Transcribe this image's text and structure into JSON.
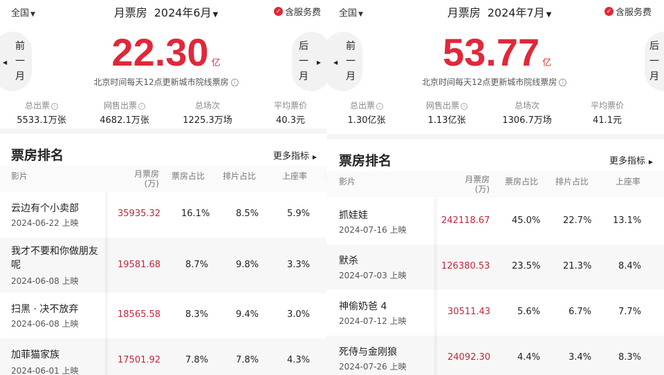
{
  "left": {
    "city": "全国",
    "month_label": "月票房",
    "month_value": "2024年6月",
    "service_fee": "含服务费",
    "prev_line1": "前",
    "prev_line2": "一",
    "prev_line3": "月",
    "next_line1": "后",
    "next_line2": "一",
    "next_line3": "月",
    "box_office": "22.30",
    "box_office_unit": "亿",
    "update_note": "北京时间每天12点更新城市院线票房",
    "stats": [
      {
        "label": "总出票",
        "value": "5533.1万张"
      },
      {
        "label": "网售出票",
        "value": "4682.1万张"
      },
      {
        "label": "总场次",
        "value": "1225.3万场"
      },
      {
        "label": "平均票价",
        "value": "40.3元"
      }
    ],
    "section_title": "票房排名",
    "more_label": "更多指标",
    "headers": {
      "film": "影片",
      "box_line1": "月票房",
      "box_line2": "(万)",
      "share": "票房占比",
      "screen": "排片占比",
      "occupancy": "上座率",
      "cut": "排"
    },
    "rows": [
      {
        "name": "云边有个小卖部",
        "date": "2024-06-22 上映",
        "box": "35935.32",
        "share": "16.1%",
        "screen": "8.5%",
        "occ": "5.9%"
      },
      {
        "name": "我才不要和你做朋友呢",
        "date": "2024-06-08 上映",
        "box": "19581.68",
        "share": "8.7%",
        "screen": "9.8%",
        "occ": "3.3%"
      },
      {
        "name": "扫黑 · 决不放弃",
        "date": "2024-06-08 上映",
        "box": "18565.58",
        "share": "8.3%",
        "screen": "9.4%",
        "occ": "3.0%"
      },
      {
        "name": "加菲猫家族",
        "date": "2024-06-01 上映",
        "box": "17501.92",
        "share": "7.8%",
        "screen": "7.8%",
        "occ": "4.3%"
      }
    ]
  },
  "right": {
    "city": "全国",
    "month_label": "月票房",
    "month_value": "2024年7月",
    "service_fee": "含服务费",
    "prev_line1": "前",
    "prev_line2": "一",
    "prev_line3": "月",
    "next_line1": "后",
    "next_line2": "一",
    "next_line3": "月",
    "box_office": "53.77",
    "box_office_unit": "亿",
    "update_note": "北京时间每天12点更新城市院线票房",
    "stats": [
      {
        "label": "总出票",
        "value": "1.30亿张"
      },
      {
        "label": "网售出票",
        "value": "1.13亿张"
      },
      {
        "label": "总场次",
        "value": "1306.7万场"
      },
      {
        "label": "平均票价",
        "value": "41.1元"
      }
    ],
    "section_title": "票房排名",
    "more_label": "更多指标",
    "headers": {
      "film": "影片",
      "box_line1": "月票房",
      "box_line2": "(万)",
      "share": "票房占比",
      "screen": "排片占比",
      "occupancy": "上座率"
    },
    "rows": [
      {
        "name": "抓娃娃",
        "date": "2024-07-16 上映",
        "box": "242118.67",
        "share": "45.0%",
        "screen": "22.7%",
        "occ": "13.1%"
      },
      {
        "name": "默杀",
        "date": "2024-07-03 上映",
        "box": "126380.53",
        "share": "23.5%",
        "screen": "21.3%",
        "occ": "8.4%"
      },
      {
        "name": "神偷奶爸 4",
        "date": "2024-07-12 上映",
        "box": "30511.43",
        "share": "5.6%",
        "screen": "6.7%",
        "occ": "7.7%"
      },
      {
        "name": "死侍与金刚狼",
        "date": "2024-07-26 上映",
        "box": "24092.30",
        "share": "4.4%",
        "screen": "3.4%",
        "occ": "8.3%"
      }
    ]
  },
  "colors": {
    "accent": "#e0283a",
    "box_value": "#c0283a"
  }
}
